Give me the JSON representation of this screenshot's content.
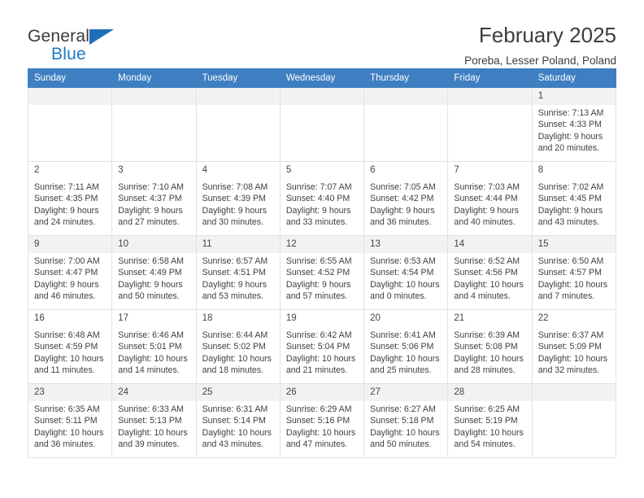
{
  "brand": {
    "line1": "General",
    "line2": "Blue",
    "triangle_color": "#1f6fb8"
  },
  "header": {
    "month_title": "February 2025",
    "location": "Poreba, Lesser Poland, Poland",
    "header_bg_color": "#3f7fc1"
  },
  "weekdays": [
    "Sunday",
    "Monday",
    "Tuesday",
    "Wednesday",
    "Thursday",
    "Friday",
    "Saturday"
  ],
  "labels": {
    "sunrise": "Sunrise:",
    "sunset": "Sunset:",
    "daylight": "Daylight:"
  },
  "weeks": [
    [
      {
        "empty": true
      },
      {
        "empty": true
      },
      {
        "empty": true
      },
      {
        "empty": true
      },
      {
        "empty": true
      },
      {
        "empty": true
      },
      {
        "day": "1",
        "sunrise": "Sunrise: 7:13 AM",
        "sunset": "Sunset: 4:33 PM",
        "daylight": "Daylight: 9 hours and 20 minutes."
      }
    ],
    [
      {
        "day": "2",
        "sunrise": "Sunrise: 7:11 AM",
        "sunset": "Sunset: 4:35 PM",
        "daylight": "Daylight: 9 hours and 24 minutes."
      },
      {
        "day": "3",
        "sunrise": "Sunrise: 7:10 AM",
        "sunset": "Sunset: 4:37 PM",
        "daylight": "Daylight: 9 hours and 27 minutes."
      },
      {
        "day": "4",
        "sunrise": "Sunrise: 7:08 AM",
        "sunset": "Sunset: 4:39 PM",
        "daylight": "Daylight: 9 hours and 30 minutes."
      },
      {
        "day": "5",
        "sunrise": "Sunrise: 7:07 AM",
        "sunset": "Sunset: 4:40 PM",
        "daylight": "Daylight: 9 hours and 33 minutes."
      },
      {
        "day": "6",
        "sunrise": "Sunrise: 7:05 AM",
        "sunset": "Sunset: 4:42 PM",
        "daylight": "Daylight: 9 hours and 36 minutes."
      },
      {
        "day": "7",
        "sunrise": "Sunrise: 7:03 AM",
        "sunset": "Sunset: 4:44 PM",
        "daylight": "Daylight: 9 hours and 40 minutes."
      },
      {
        "day": "8",
        "sunrise": "Sunrise: 7:02 AM",
        "sunset": "Sunset: 4:45 PM",
        "daylight": "Daylight: 9 hours and 43 minutes."
      }
    ],
    [
      {
        "day": "9",
        "sunrise": "Sunrise: 7:00 AM",
        "sunset": "Sunset: 4:47 PM",
        "daylight": "Daylight: 9 hours and 46 minutes."
      },
      {
        "day": "10",
        "sunrise": "Sunrise: 6:58 AM",
        "sunset": "Sunset: 4:49 PM",
        "daylight": "Daylight: 9 hours and 50 minutes."
      },
      {
        "day": "11",
        "sunrise": "Sunrise: 6:57 AM",
        "sunset": "Sunset: 4:51 PM",
        "daylight": "Daylight: 9 hours and 53 minutes."
      },
      {
        "day": "12",
        "sunrise": "Sunrise: 6:55 AM",
        "sunset": "Sunset: 4:52 PM",
        "daylight": "Daylight: 9 hours and 57 minutes."
      },
      {
        "day": "13",
        "sunrise": "Sunrise: 6:53 AM",
        "sunset": "Sunset: 4:54 PM",
        "daylight": "Daylight: 10 hours and 0 minutes."
      },
      {
        "day": "14",
        "sunrise": "Sunrise: 6:52 AM",
        "sunset": "Sunset: 4:56 PM",
        "daylight": "Daylight: 10 hours and 4 minutes."
      },
      {
        "day": "15",
        "sunrise": "Sunrise: 6:50 AM",
        "sunset": "Sunset: 4:57 PM",
        "daylight": "Daylight: 10 hours and 7 minutes."
      }
    ],
    [
      {
        "day": "16",
        "sunrise": "Sunrise: 6:48 AM",
        "sunset": "Sunset: 4:59 PM",
        "daylight": "Daylight: 10 hours and 11 minutes."
      },
      {
        "day": "17",
        "sunrise": "Sunrise: 6:46 AM",
        "sunset": "Sunset: 5:01 PM",
        "daylight": "Daylight: 10 hours and 14 minutes."
      },
      {
        "day": "18",
        "sunrise": "Sunrise: 6:44 AM",
        "sunset": "Sunset: 5:02 PM",
        "daylight": "Daylight: 10 hours and 18 minutes."
      },
      {
        "day": "19",
        "sunrise": "Sunrise: 6:42 AM",
        "sunset": "Sunset: 5:04 PM",
        "daylight": "Daylight: 10 hours and 21 minutes."
      },
      {
        "day": "20",
        "sunrise": "Sunrise: 6:41 AM",
        "sunset": "Sunset: 5:06 PM",
        "daylight": "Daylight: 10 hours and 25 minutes."
      },
      {
        "day": "21",
        "sunrise": "Sunrise: 6:39 AM",
        "sunset": "Sunset: 5:08 PM",
        "daylight": "Daylight: 10 hours and 28 minutes."
      },
      {
        "day": "22",
        "sunrise": "Sunrise: 6:37 AM",
        "sunset": "Sunset: 5:09 PM",
        "daylight": "Daylight: 10 hours and 32 minutes."
      }
    ],
    [
      {
        "day": "23",
        "sunrise": "Sunrise: 6:35 AM",
        "sunset": "Sunset: 5:11 PM",
        "daylight": "Daylight: 10 hours and 36 minutes."
      },
      {
        "day": "24",
        "sunrise": "Sunrise: 6:33 AM",
        "sunset": "Sunset: 5:13 PM",
        "daylight": "Daylight: 10 hours and 39 minutes."
      },
      {
        "day": "25",
        "sunrise": "Sunrise: 6:31 AM",
        "sunset": "Sunset: 5:14 PM",
        "daylight": "Daylight: 10 hours and 43 minutes."
      },
      {
        "day": "26",
        "sunrise": "Sunrise: 6:29 AM",
        "sunset": "Sunset: 5:16 PM",
        "daylight": "Daylight: 10 hours and 47 minutes."
      },
      {
        "day": "27",
        "sunrise": "Sunrise: 6:27 AM",
        "sunset": "Sunset: 5:18 PM",
        "daylight": "Daylight: 10 hours and 50 minutes."
      },
      {
        "day": "28",
        "sunrise": "Sunrise: 6:25 AM",
        "sunset": "Sunset: 5:19 PM",
        "daylight": "Daylight: 10 hours and 54 minutes."
      },
      {
        "empty": true
      }
    ]
  ]
}
